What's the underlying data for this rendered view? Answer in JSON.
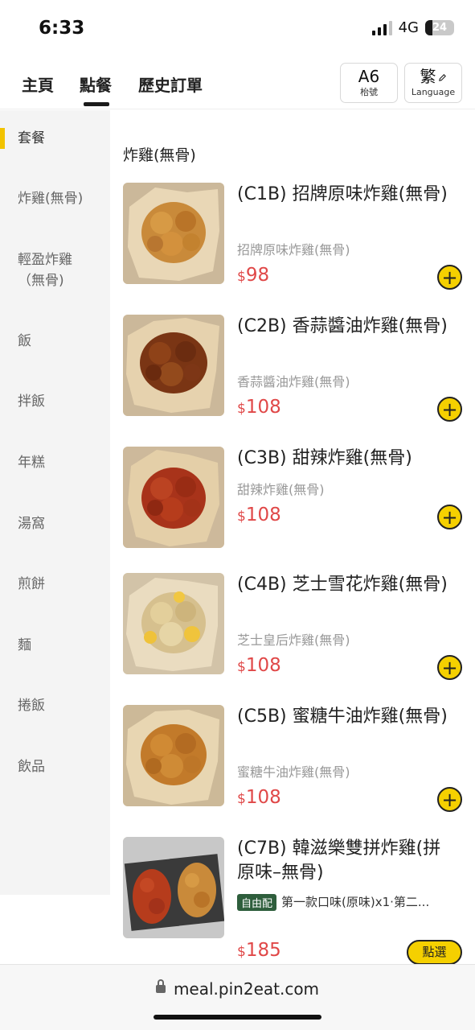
{
  "status_bar": {
    "time": "6:33",
    "network": "4G",
    "battery": "24",
    "battery_level": 0.24
  },
  "header": {
    "tabs": [
      "主頁",
      "點餐",
      "歷史訂單"
    ],
    "active_tab": "點餐",
    "table_button": {
      "value": "A6",
      "label": "枱號"
    },
    "language_button": {
      "value": "繁",
      "label": "Language",
      "icon": "pencil-icon"
    }
  },
  "sidebar": {
    "categories": [
      "套餐",
      "炸雞(無骨)",
      "輕盈炸雞\n（無骨)",
      "飯",
      "拌飯",
      "年糕",
      "湯窩",
      "煎餅",
      "麵",
      "捲飯",
      "飲品"
    ],
    "active_index": 0,
    "accent": "#f2c300"
  },
  "main": {
    "section_title": "炸雞(無骨)",
    "currency": "$",
    "items": [
      {
        "name": "(C1B) 招牌原味炸雞(無骨)",
        "desc": "招牌原味炸雞(無骨)",
        "price": "98",
        "action": "+"
      },
      {
        "name": "(C2B) 香蒜醬油炸雞(無骨)",
        "desc": "香蒜醬油炸雞(無骨)",
        "price": "108",
        "action": "+"
      },
      {
        "name": "(C3B) 甜辣炸雞(無骨)",
        "desc": "甜辣炸雞(無骨)",
        "price": "108",
        "action": "+"
      },
      {
        "name": "(C4B) 芝士雪花炸雞(無骨)",
        "desc": "芝士皇后炸雞(無骨)",
        "price": "108",
        "action": "+"
      },
      {
        "name": "(C5B) 蜜糖牛油炸雞(無骨)",
        "desc": "蜜糖牛油炸雞(無骨)",
        "price": "108",
        "action": "+"
      },
      {
        "name": "(C7B) 韓滋樂雙拼炸雞(拼原味–無骨)",
        "tag": "自由配",
        "desc": "第一款口味(原味)x1·第二...",
        "price": "185",
        "action": "點選"
      }
    ],
    "price_color": "#e04848",
    "button_color": "#f5d000"
  },
  "browser": {
    "url": "meal.pin2eat.com",
    "icon": "lock-icon"
  }
}
